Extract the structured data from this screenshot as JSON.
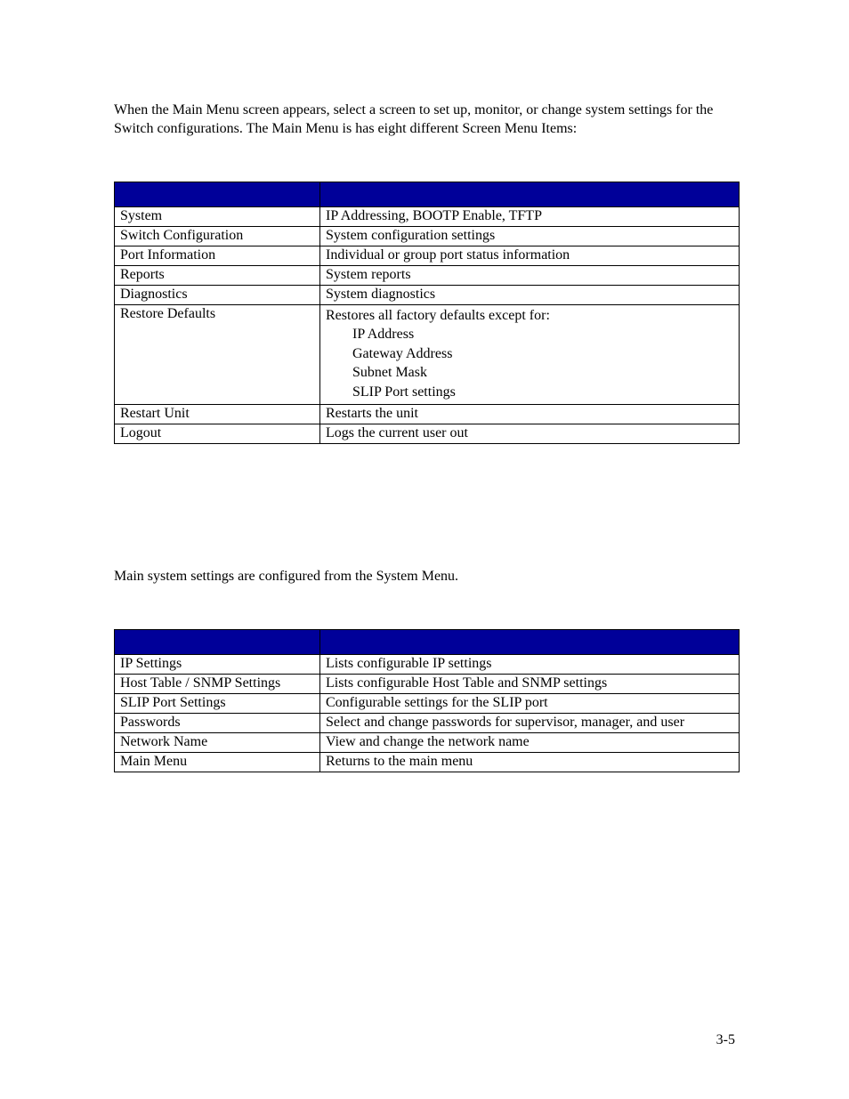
{
  "intro": "When the Main Menu screen appears, select a screen to set up, monitor, or change system settings for the Switch configurations. The Main Menu is has eight different Screen Menu Items:",
  "table1": {
    "rows": [
      {
        "c1": "System",
        "c2": "IP Addressing, BOOTP Enable, TFTP"
      },
      {
        "c1": "Switch Configuration",
        "c2": "System configuration settings"
      },
      {
        "c1": "Port Information",
        "c2": "Individual or group port status information"
      },
      {
        "c1": "Reports",
        "c2": "System reports"
      },
      {
        "c1": "Diagnostics",
        "c2": "System diagnostics"
      }
    ],
    "restore_label": "Restore Defaults",
    "restore_line1": "Restores all factory defaults except for:",
    "restore_items": [
      "IP Address",
      "Gateway Address",
      "Subnet Mask",
      "SLIP Port settings"
    ],
    "rows_after": [
      {
        "c1": "Restart Unit",
        "c2": "Restarts the unit"
      },
      {
        "c1": "Logout",
        "c2": "Logs the current user out"
      }
    ]
  },
  "section2_intro": "Main system settings are configured from the System Menu.",
  "table2": {
    "rows": [
      {
        "c1": "IP Settings",
        "c2": "Lists configurable IP settings"
      },
      {
        "c1": "Host Table / SNMP Settings",
        "c2": "Lists configurable Host Table and SNMP settings"
      },
      {
        "c1": "SLIP Port Settings",
        "c2": "Configurable settings for the SLIP port"
      },
      {
        "c1": "Passwords",
        "c2": "Select and change passwords for supervisor, manager, and user"
      },
      {
        "c1": "Network Name",
        "c2": "View and change the network name"
      },
      {
        "c1": "Main Menu",
        "c2": "Returns to the main menu"
      }
    ]
  },
  "pagenum": "3-5"
}
